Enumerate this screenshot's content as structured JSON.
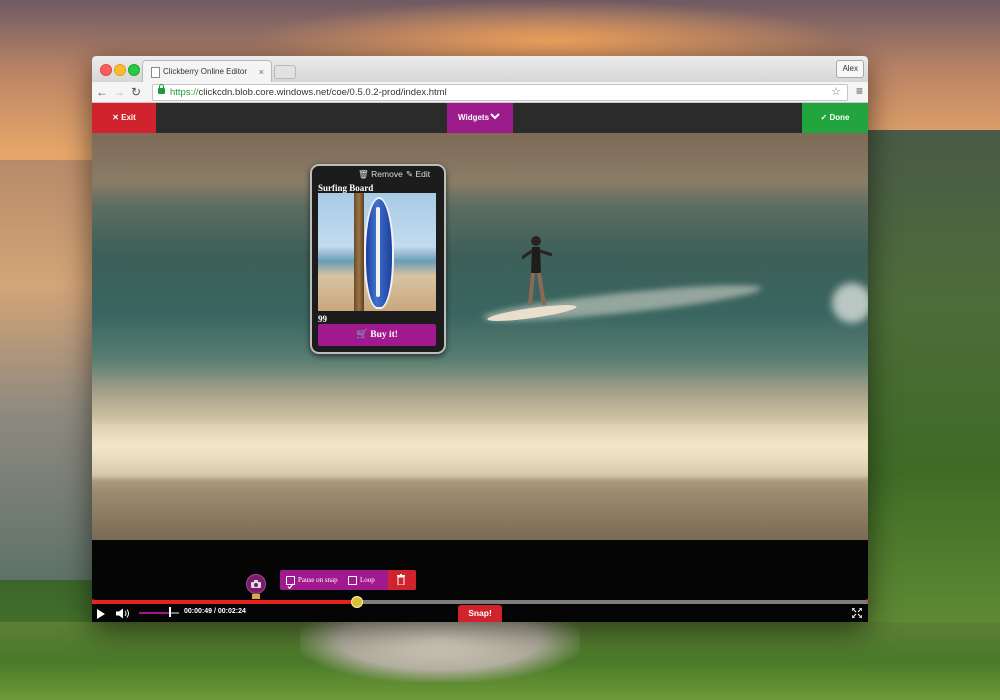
{
  "browser": {
    "tab_title": "Clickberry Online Editor",
    "tab_close": "×",
    "user_label": "Alex",
    "url_scheme": "https://",
    "url_rest": "clickcdn.blob.core.windows.net/coe/0.5.0.2-prod/index.html",
    "nav_back": "←",
    "nav_forward": "→",
    "nav_reload": "↻",
    "star": "☆",
    "menu": "≡"
  },
  "editor": {
    "exit_label": "✕  Exit",
    "widgets_label": "Widgets",
    "done_label": "✓  Done"
  },
  "widget": {
    "remove_label": "🗑 Remove",
    "edit_label": "✎ Edit",
    "title": "Surfing Board",
    "price": "99",
    "buy_label": "🛒 Buy it!"
  },
  "timeline": {
    "pause_on_snap_label": "Pause on snap",
    "loop_label": "Loop",
    "pause_on_snap_checked": true,
    "loop_checked": false,
    "time_display": "00:00:49 / 00:02:24",
    "snap_label": "Snap!",
    "progress_fraction": 0.34,
    "volume_fraction": 0.75,
    "marker_tag": "1"
  },
  "colors": {
    "accent_magenta": "#a1198f",
    "exit_red": "#d0232d",
    "done_green": "#22a43f",
    "progress_red": "#e5231f"
  },
  "icons": [
    "lock-icon",
    "star-icon",
    "menu-icon",
    "close-icon",
    "chevron-down-icon",
    "check-icon",
    "trash-icon",
    "edit-icon",
    "cart-icon",
    "camera-icon",
    "play-icon",
    "volume-icon",
    "fullscreen-icon"
  ]
}
